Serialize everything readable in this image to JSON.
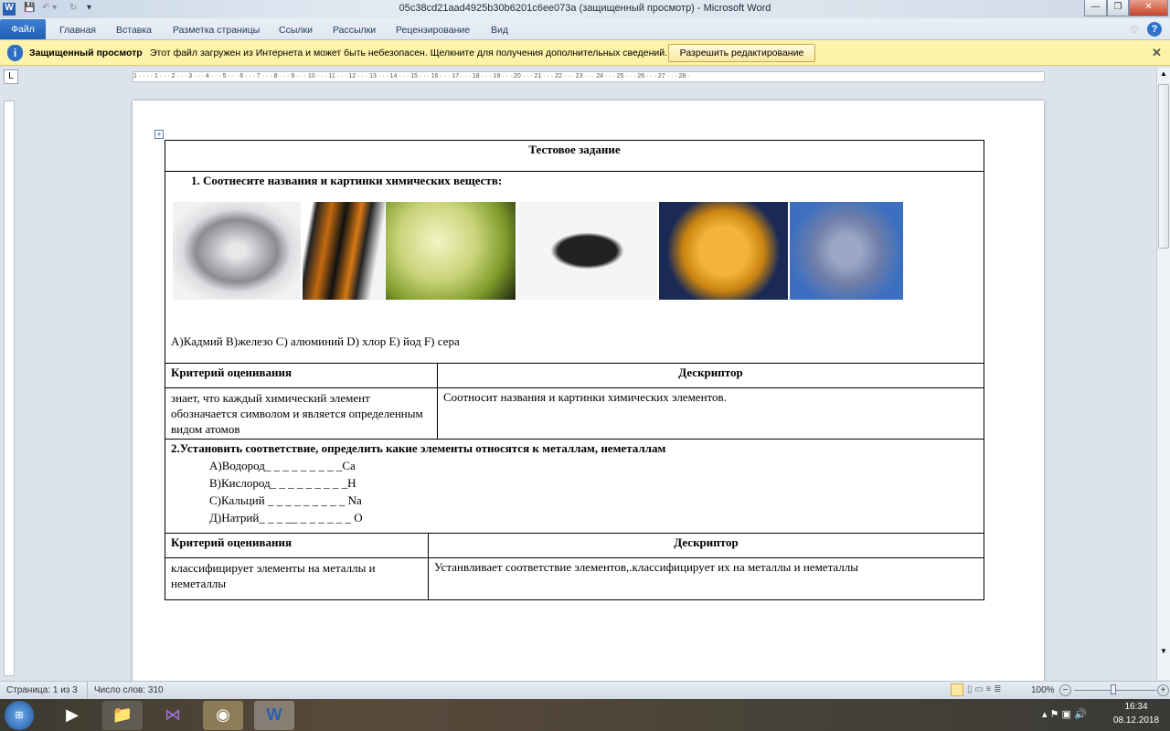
{
  "window": {
    "title": "05c38cd21aad4925b30b6201c6ee073a (защищенный просмотр)  -  Microsoft Word"
  },
  "tabs": [
    "Файл",
    "Главная",
    "Вставка",
    "Разметка страницы",
    "Ссылки",
    "Рассылки",
    "Рецензирование",
    "Вид"
  ],
  "message_bar": {
    "title": "Защищенный просмотр",
    "text": "Этот файл загружен из Интернета и может быть небезопасен. Щелкните для получения дополнительных сведений.",
    "button": "Разрешить редактирование"
  },
  "ruler": "1 · · · · 1 · · · 2 · · · 3 · · · 4 · · · 5 · · · 6 · · · 7 · · · 8 · · · 9 · · · 10 · · · 11 · · · 12 · · · 13 · · · 14 · · · 15 · · · 16 · · · 17 · · · 18 · · · 19 · · · 20 · · · 21 · · · 22 · · · 23 · · · 24 · · · 25 · · · 26 · · · 27 · · · 28 ·",
  "document": {
    "title": "Тестовое задание",
    "q1": "1.   Соотнесите названия и картинки химических веществ:",
    "q1_options": "А)Кадмий  В)железо С) алюминий D) хлор E) йод F) сера",
    "criteria_header": "Критерий оценивания",
    "descriptor_header": "Дескриптор",
    "q1_criterion": "знает, что каждый химический элемент обозначается символом и является определенным видом атомов",
    "q1_descriptor": "Соотносит названия и картинки химических элементов.",
    "q2": "2.Установить соответствие, определить какие элементы относятся к металлам, неметаллам",
    "q2_items": [
      "А)Водород_ _ _ _ _ _ _ _ _Са",
      "В)Кислород_ _ _ _ _ _ _ _ _Н",
      "С)Кальций _ _ _ _ _ _ _ _ _ Na",
      "Д)Натрий_ _ _ __ _ _ _ _ _ _ О"
    ],
    "q2_criterion": "классифицирует элементы на металлы и неметаллы",
    "q2_descriptor": "Устанвливает соответствие элементов,.классифицирует их на металлы  и неметаллы"
  },
  "status": {
    "page": "Страница: 1 из 3",
    "words": "Число слов: 310",
    "zoom": "100%"
  },
  "tray": {
    "time": "16:34",
    "date": "08.12.2018"
  }
}
